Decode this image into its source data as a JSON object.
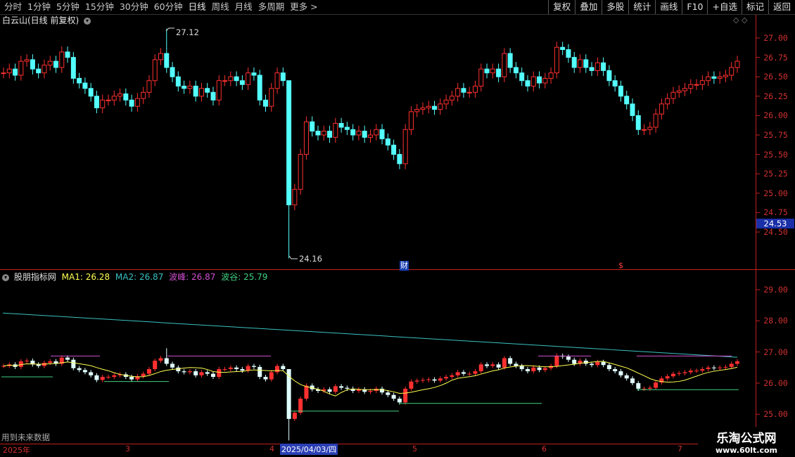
{
  "toolbar": {
    "left_items": [
      "分时",
      "1分钟",
      "5分钟",
      "15分钟",
      "30分钟",
      "60分钟",
      "日线",
      "周线",
      "月线",
      "多周期",
      "更多 >"
    ],
    "right_items": [
      "复权",
      "叠加",
      "多股",
      "统计",
      "画线",
      "F10",
      "+自选",
      "标记",
      "返回"
    ]
  },
  "main_chart": {
    "title": "白云山(日线 前复权)",
    "high_marker": "27.12",
    "low_marker": "24.16",
    "current_price": "24.53",
    "finance_marker": "财",
    "dollar_marker": "$",
    "y_ticks": [
      "27.00",
      "26.75",
      "26.50",
      "26.25",
      "26.00",
      "25.75",
      "25.50",
      "25.25",
      "25.00",
      "24.75",
      "24.50"
    ]
  },
  "indicator": {
    "name": "股朋指标网",
    "ma1_label": "MA1: 26.28",
    "ma2_label": "MA2: 26.87",
    "peak_label": "波峰: 26.87",
    "valley_label": "波谷: 25.79",
    "y_ticks": [
      "29.00",
      "28.00",
      "27.00",
      "26.00",
      "25.00"
    ],
    "footnote": "用到未来数据"
  },
  "dates": {
    "year": "2025年",
    "months": [
      "3",
      "4",
      "5",
      "6",
      "7"
    ],
    "cursor": "2025/04/03/四"
  },
  "watermark": {
    "brand": "乐淘公式网",
    "url": "www.60lt.com"
  },
  "colors": {
    "up": "#ff3030",
    "down": "#54ffff",
    "ma1": "#ffff50",
    "ma2": "#3ac0c0",
    "peak": "#d050d0",
    "valley": "#40d080",
    "axis": "#c02020"
  }
}
